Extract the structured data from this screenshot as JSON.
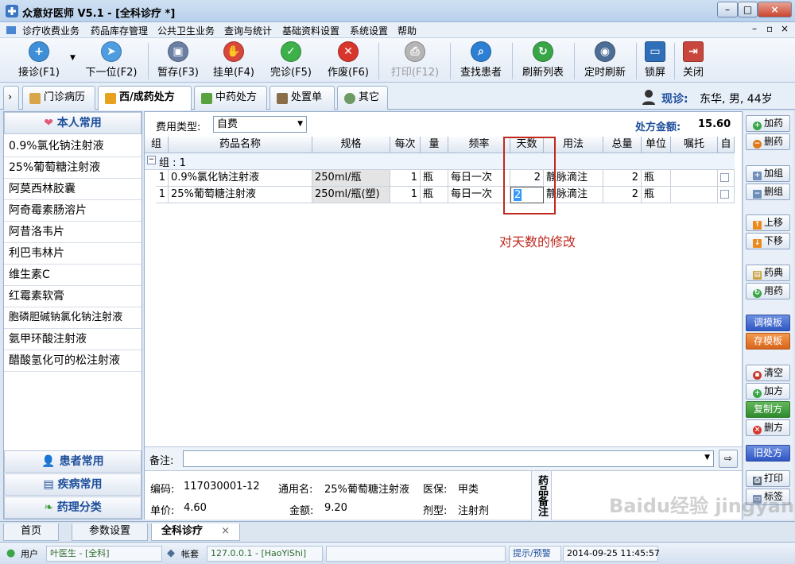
{
  "window": {
    "title": "众意好医师 V5.1 - [全科诊疗 *]"
  },
  "menu": [
    "诊疗收费业务",
    "药品库存管理",
    "公共卫生业务",
    "查询与统计",
    "基础资料设置",
    "系统设置",
    "帮助"
  ],
  "toolbar": [
    {
      "label": "接诊(F1)",
      "icon": "reception-icon"
    },
    {
      "label": "下一位(F2)",
      "icon": "next-patient-icon"
    },
    {
      "label": "暂存(F3)",
      "icon": "save-temp-icon"
    },
    {
      "label": "挂单(F4)",
      "icon": "hang-order-icon"
    },
    {
      "label": "完诊(F5)",
      "icon": "complete-icon"
    },
    {
      "label": "作废(F6)",
      "icon": "void-icon"
    },
    {
      "label": "打印(F12)",
      "icon": "print-icon"
    },
    {
      "label": "查找患者",
      "icon": "find-patient-icon"
    },
    {
      "label": "刷新列表",
      "icon": "refresh-list-icon"
    },
    {
      "label": "定时刷新",
      "icon": "timed-refresh-icon"
    },
    {
      "label": "锁屏",
      "icon": "lock-screen-icon"
    },
    {
      "label": "关闭",
      "icon": "close-icon"
    }
  ],
  "tabs": [
    "门诊病历",
    "西/成药处方",
    "中药处方",
    "处置单",
    "其它"
  ],
  "current_patient": {
    "label": "现诊:",
    "value": "东华, 男, 44岁"
  },
  "left": {
    "header": "本人常用",
    "items": [
      "0.9%氯化钠注射液",
      "25%葡萄糖注射液",
      "阿莫西林胶囊",
      "阿奇霉素肠溶片",
      "阿昔洛韦片",
      "利巴韦林片",
      "维生素C",
      "红霉素软膏",
      "胞磷胆碱钠氯化钠注射液",
      "氨甲环酸注射液",
      "醋酸氢化可的松注射液"
    ],
    "footer": [
      "患者常用",
      "疾病常用",
      "药理分类"
    ]
  },
  "prescription": {
    "fee_type_label": "费用类型:",
    "fee_type_value": "自费",
    "amount_label": "处方金额:",
    "amount_value": "15.60",
    "columns": [
      "组",
      "药品名称",
      "规格",
      "每次",
      "量",
      "频率",
      "天数",
      "用法",
      "总量",
      "单位",
      "嘱托",
      "自"
    ],
    "group_label": "组 : 1",
    "rows": [
      {
        "group": "1",
        "name": "0.9%氯化钠注射液",
        "spec": "250ml/瓶",
        "dose": "1",
        "unit1": "瓶",
        "freq": "每日一次",
        "days": "2",
        "usage": "静脉滴注",
        "total": "2",
        "unit2": "瓶",
        "note": ""
      },
      {
        "group": "1",
        "name": "25%葡萄糖注射液",
        "spec": "250ml/瓶(塑)",
        "dose": "1",
        "unit1": "瓶",
        "freq": "每日一次",
        "days": "2",
        "usage": "静脉滴注",
        "total": "2",
        "unit2": "瓶",
        "note": ""
      }
    ],
    "annotation": "对天数的修改",
    "annotation_color": "#c0281e"
  },
  "note": {
    "label": "备注:",
    "value": ""
  },
  "drug_info": {
    "code_label": "编码:",
    "code": "117030001-12",
    "generic_label": "通用名:",
    "generic": "25%葡萄糖注射液",
    "insurance_label": "医保:",
    "insurance": "甲类",
    "price_label": "单价:",
    "price": "4.60",
    "amount_label": "金额:",
    "amount": "9.20",
    "form_label": "剂型:",
    "form": "注射剂",
    "side_label": "药品备注"
  },
  "right_buttons": [
    "加药",
    "删药",
    "加组",
    "删组",
    "上移",
    "下移",
    "药典",
    "用药",
    "调模板",
    "存模板",
    "清空",
    "加方",
    "复制方",
    "删方",
    "旧处方",
    "打印",
    "标签"
  ],
  "bottom_tabs": [
    "首页",
    "参数设置",
    "全科诊疗"
  ],
  "status": {
    "user_label": "用户",
    "user": "叶医生 - [全科]",
    "account_label": "帐套",
    "server": "127.0.0.1 - [HaoYiShi]",
    "alert": "提示/预警",
    "datetime": "2014-09-25 11:45:57"
  },
  "watermark": "Baidu经验 jingyan.baidu.com"
}
